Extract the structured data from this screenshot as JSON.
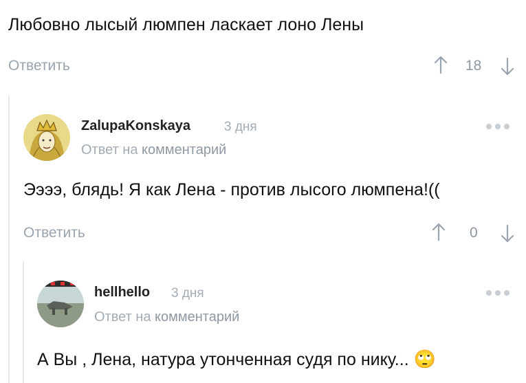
{
  "comments": [
    {
      "text": "Любовно лысый люмпен ласкает лоно Лены",
      "reply_label": "Ответить",
      "votes": "18"
    },
    {
      "username": "ZalupaKonskaya",
      "time": "3 дня",
      "reply_to_prefix": "Ответ на",
      "reply_to_link": "комментарий",
      "text": "Ээээ, блядь! Я как Лена - против лысого люмпена!((",
      "reply_label": "Ответить",
      "votes": "0",
      "avatar": "queen-avatar"
    },
    {
      "username": "hellhello",
      "time": "3 дня",
      "reply_to_prefix": "Ответ на",
      "reply_to_link": "комментарий",
      "text": "А Вы , Лена, натура утонченная судя по нику...",
      "emoji": "🙄",
      "avatar": "photo-avatar"
    }
  ],
  "icons": {
    "upvote": "arrow-up-icon",
    "downvote": "arrow-down-icon",
    "more": "more-dots-icon"
  },
  "colors": {
    "muted": "#9aa4ae",
    "thread_line": "#e6e8ea",
    "dots": "#c7cdd3"
  }
}
